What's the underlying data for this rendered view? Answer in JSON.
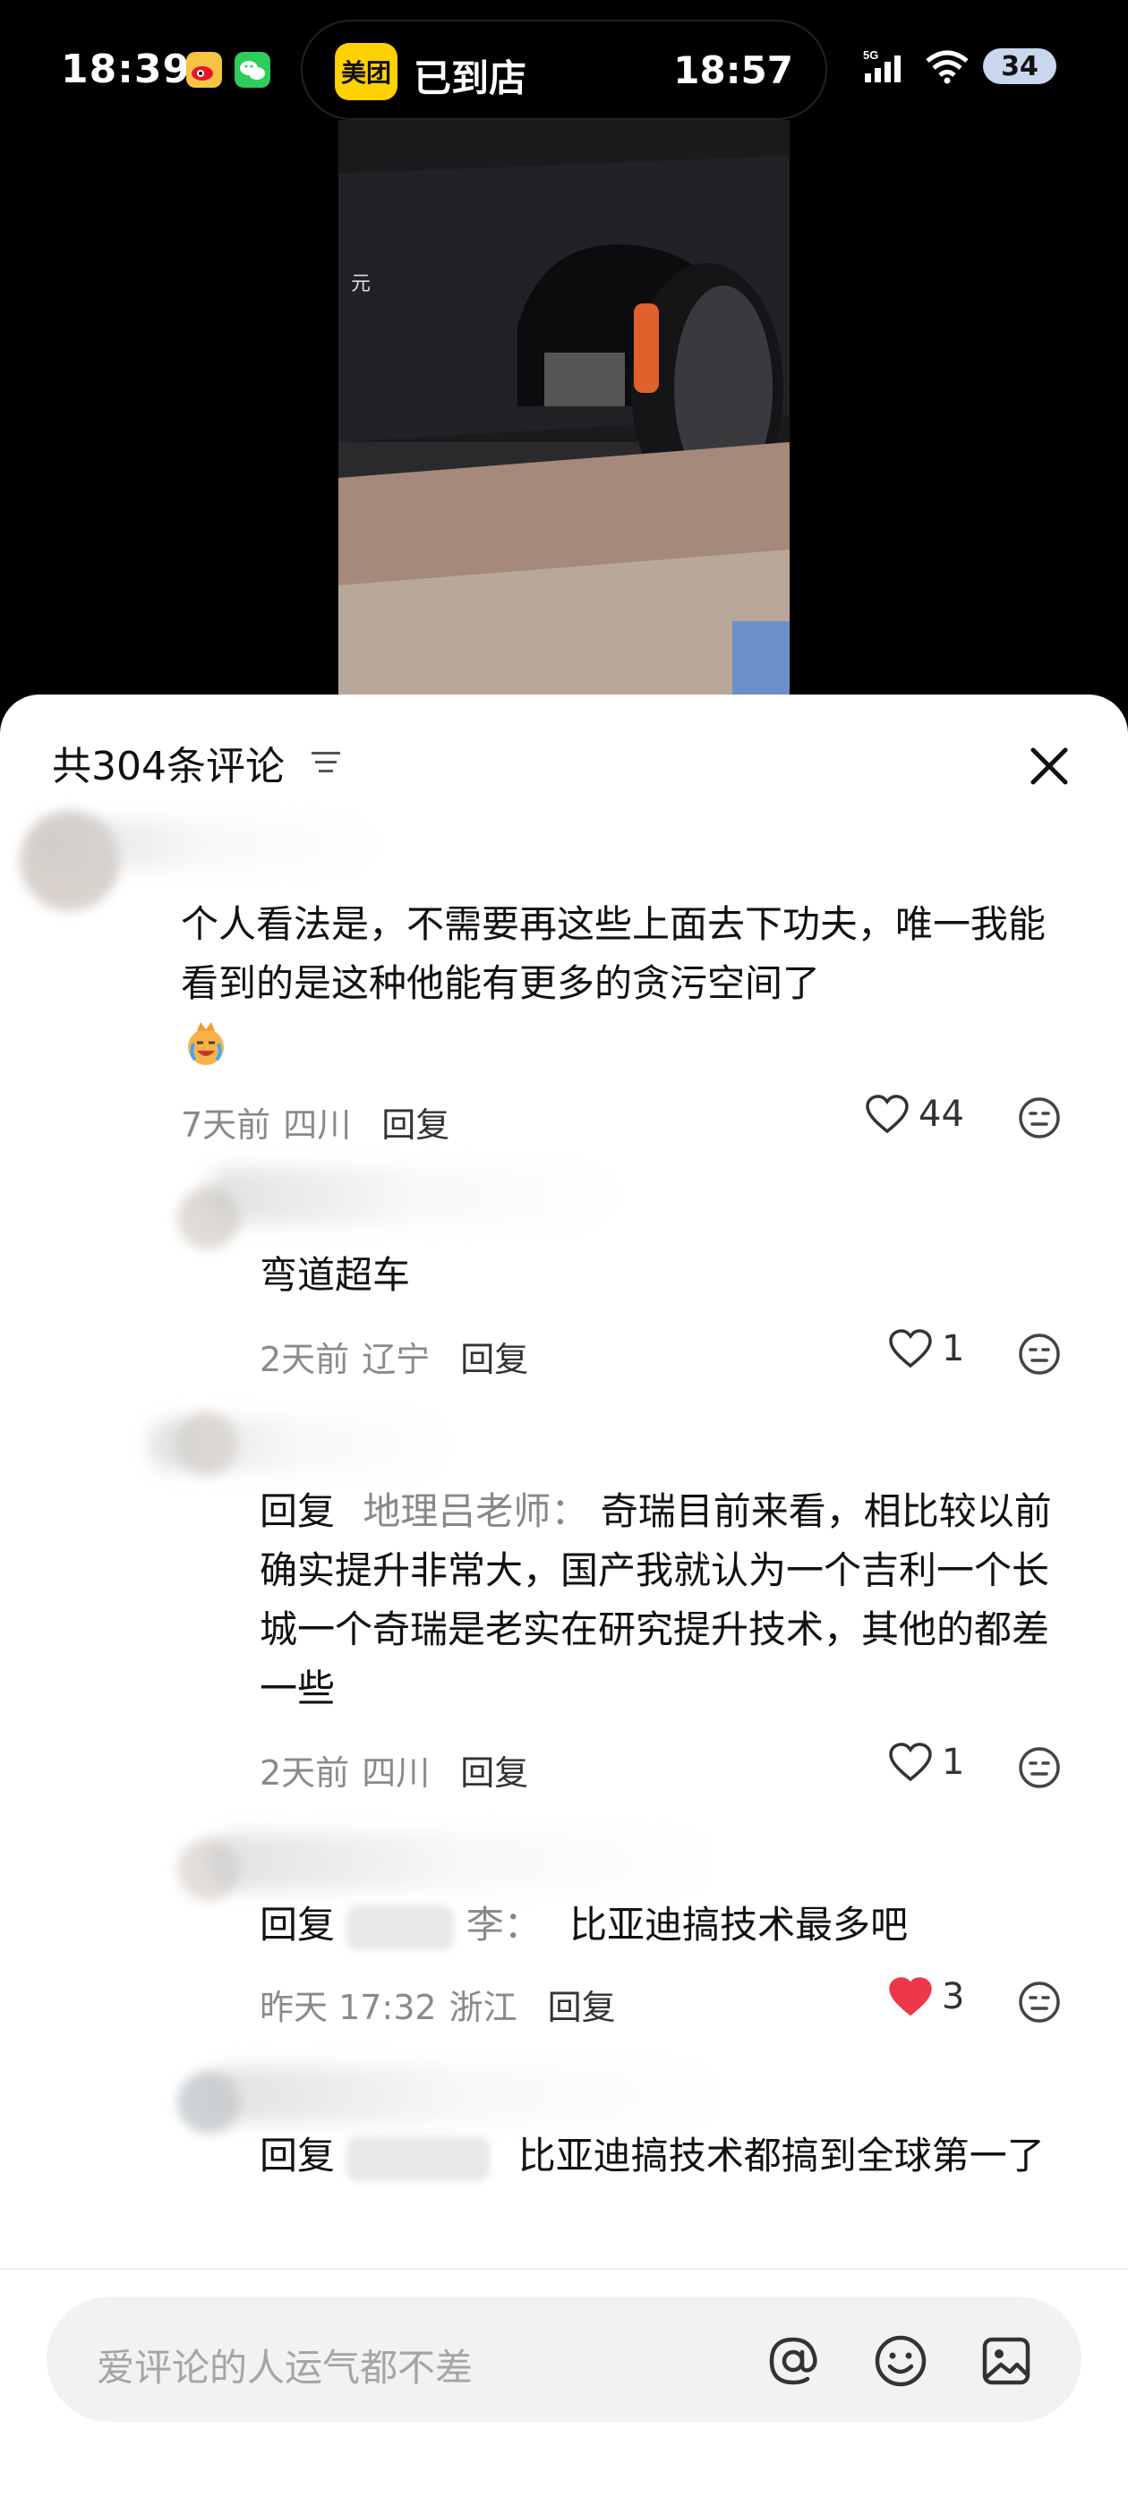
{
  "status_bar": {
    "time": "18:39",
    "island_app": "美团",
    "island_status": "已到店",
    "island_time": "18:57",
    "network": "5G",
    "battery": "34"
  },
  "sheet": {
    "title": "共304条评论"
  },
  "comments": [
    {
      "text": "个人看法是，不需要再这些上面去下功夫，唯一我能看到的是这种他能有更多的贪污空间了",
      "time": "7天前",
      "location": "四川",
      "reply_label": "回复",
      "likes": "44",
      "liked": false
    },
    {
      "text": "弯道超车",
      "time": "2天前",
      "location": "辽宁",
      "reply_label": "回复",
      "likes": "1",
      "liked": false
    },
    {
      "reply_prefix": "回复",
      "reply_to": "地理吕老师：",
      "text": "奇瑞目前来看，相比较以前确实提升非常大，国产我就认为一个吉利一个长城一个奇瑞是老实在研究提升技术，其他的都差一些",
      "time": "2天前",
      "location": "四川",
      "reply_label": "回复",
      "likes": "1",
      "liked": false
    },
    {
      "reply_prefix": "回复",
      "reply_to": "李：",
      "text": "比亚迪搞技术最多吧",
      "time": "昨天 17:32",
      "location": "浙江",
      "reply_label": "回复",
      "likes": "3",
      "liked": true
    },
    {
      "reply_prefix": "回复",
      "reply_to": "",
      "text": "比亚迪搞技术都搞到全球第一了"
    }
  ],
  "input": {
    "placeholder": "爱评论的人运气都不差"
  },
  "colors": {
    "liked_heart": "#f0374a",
    "meituan_yellow": "#ffd100",
    "battery_bg": "#c9d7ee"
  },
  "icons": [
    "weibo-icon",
    "wechat-icon",
    "signal-icon",
    "wifi-icon",
    "sort-icon",
    "close-icon",
    "heart-icon",
    "emoji-icon",
    "at-icon",
    "image-icon"
  ]
}
